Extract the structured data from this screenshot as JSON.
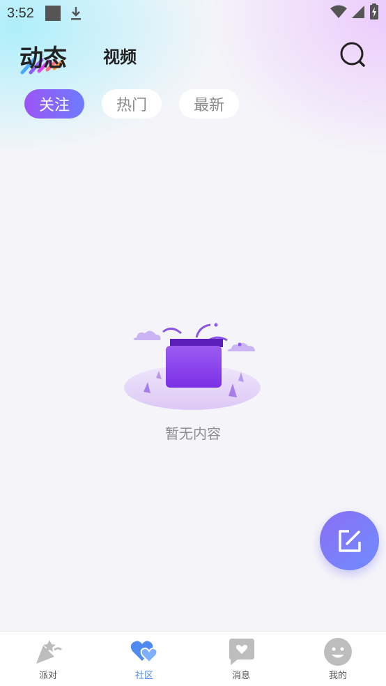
{
  "status_bar": {
    "time": "3:52"
  },
  "header": {
    "title_active": "动态",
    "title_video": "视频"
  },
  "chips": [
    {
      "label": "关注",
      "active": true
    },
    {
      "label": "热门",
      "active": false
    },
    {
      "label": "最新",
      "active": false
    }
  ],
  "empty_state": {
    "text": "暂无内容"
  },
  "tabbar": {
    "items": [
      {
        "label": "派对",
        "icon": "party-popper-icon"
      },
      {
        "label": "社区",
        "icon": "heart-community-icon",
        "active": true
      },
      {
        "label": "消息",
        "icon": "message-heart-icon"
      },
      {
        "label": "我的",
        "icon": "smiley-face-icon"
      }
    ]
  },
  "colors": {
    "accent_purple": "#9b55f5",
    "accent_blue": "#6d7bff",
    "tab_active": "#4e8af0"
  }
}
